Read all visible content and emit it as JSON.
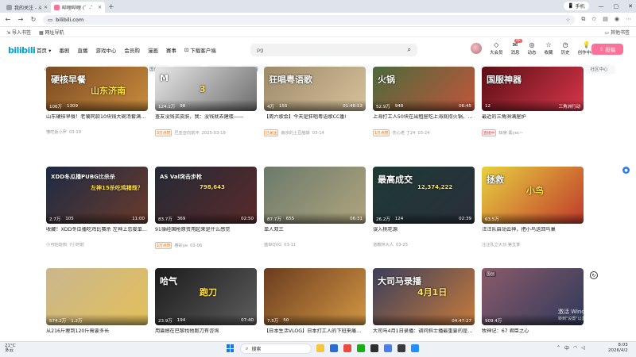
{
  "browser": {
    "tabs": [
      {
        "label": "我的关注 - 斗鱼",
        "active": false
      },
      {
        "label": "哔哩哔哩 (゜-゜)つ",
        "active": true
      }
    ],
    "new_tab": "+",
    "window_controls": [
      "—",
      "▢",
      "✕"
    ],
    "profile_badge": "手机",
    "url": "bilibili.com",
    "bookmarks": [
      "导入书签",
      "网址导航"
    ],
    "other_bookmarks": "其他书签"
  },
  "site": {
    "logo": "bilibili",
    "topnav": [
      "首页",
      "番剧",
      "直播",
      "游戏中心",
      "会员购",
      "漫画",
      "赛事",
      "下载客户端"
    ],
    "search_placeholder": "pg",
    "right_nav": [
      {
        "label": "大会员",
        "icon": "◇"
      },
      {
        "label": "消息",
        "icon": "✉",
        "count": "46"
      },
      {
        "label": "动态",
        "icon": "◎"
      },
      {
        "label": "收藏",
        "icon": "☆"
      },
      {
        "label": "历史",
        "icon": "◷"
      },
      {
        "label": "创作中心",
        "icon": "💡"
      }
    ],
    "upload_label": "投稿",
    "channels_main": [
      "动态",
      "热门"
    ],
    "channel_chips": [
      "番剧",
      "国创",
      "综艺",
      "动画",
      "鬼畜",
      "舞蹈",
      "娱乐",
      "科技数码",
      "美食",
      "汽车",
      "体育运动",
      "vlog",
      "专栏",
      "活动",
      "社区中心"
    ]
  },
  "cards": [
    {
      "title": "山东硬核早餐！老饕同款10块钱大碗汤套满纯牛肉！南方小伙一口香迷糊了~",
      "views": "106万",
      "comments": "1309",
      "duration": "",
      "author": "懂吃饭小罗",
      "date": "03-19",
      "tag": "",
      "thumb_text": [
        "硬核早餐",
        "山东济南"
      ],
      "colors": [
        "#7a4a22",
        "#c98b3c"
      ]
    },
    {
      "title": "查友没钱买皮肤，我：没钱就去建楼——",
      "views": "124.1万",
      "comments": "98",
      "duration": "",
      "author": "巴亚亚向前冲",
      "date": "2025-03-18",
      "tag": "3万点赞",
      "thumb_text": [
        "M",
        "3"
      ],
      "colors": [
        "#e8e8e8",
        "#6d6d6d"
      ]
    },
    {
      "title": "【周六歌会】今天是狂唱粤语歌CC番!",
      "views": "4万",
      "comments": "155",
      "duration": "01:48:53",
      "author": "南京的土豆脑袋",
      "date": "03-14",
      "tag": "已关注",
      "thumb_text": [
        "狂唱粤语歌"
      ],
      "colors": [
        "#9c8a6a",
        "#d6c19a"
      ]
    },
    {
      "title": "上海打工人50块在出租屋吃上海底捞火锅，简单又满足",
      "views": "52.9万",
      "comments": "948",
      "duration": "06:45",
      "author": "伤心老 丁24",
      "date": "03-24",
      "tag": "1万点赞",
      "thumb_text": [
        "火锅"
      ],
      "colors": [
        "#4b6a3b",
        "#c2553b"
      ]
    },
    {
      "title": "最近的三角洲满屋护",
      "views": "12",
      "comments": "",
      "duration": "三角洲行动",
      "author": "缺席 黑yec~",
      "date": "",
      "tag": "直播中",
      "thumb_text": [
        "国服神器"
      ],
      "colors": [
        "#5a0f14",
        "#d8364a"
      ]
    },
    {
      "title": "收藏！XDD冬瓜播吃鸡比赛杀 左神上恋度单人15杀！骑你的没看到人也打 给冬瓜送 …",
      "views": "2.7万",
      "comments": "105",
      "duration": "11:00",
      "author": "小可怕烧肉",
      "date": "7小时前",
      "tag": "",
      "thumb_text": [
        "XDD冬瓜播PUBG比杀杀",
        "左神15杀吃鸡猪哉？"
      ],
      "colors": [
        "#1d2a44",
        "#6a3b2b"
      ]
    },
    {
      "title": "91操经国枪原资用起来是什么感觉",
      "views": "83.7万",
      "comments": "369",
      "duration": "02:50",
      "author": "春彩ye",
      "date": "03-06",
      "tag": "1万点赞",
      "thumb_text": [
        "AS Val突击步枪",
        "798,643"
      ],
      "colors": [
        "#242a36",
        "#5a2a2a"
      ]
    },
    {
      "title": "单人双三",
      "views": "87.7万",
      "comments": "655",
      "duration": "06:31",
      "author": "盛世QVG",
      "date": "03-11",
      "tag": "",
      "thumb_text": [],
      "colors": [
        "#6b7a6b",
        "#b0a47e"
      ]
    },
    {
      "title": "误入桃花源",
      "views": "26.2万",
      "comments": "124",
      "duration": "02:39",
      "author": "道教林大人",
      "date": "03-25",
      "tag": "",
      "thumb_text": [
        "最高成交",
        "12,374,222"
      ],
      "colors": [
        "#1e3a36",
        "#2a2f3a"
      ]
    },
    {
      "title": "汪汪队启动云神，把小鸟送回鸟巢",
      "views": "63.5万",
      "comments": "",
      "duration": "",
      "author": "汪汪队立大功 第五季",
      "date": "",
      "tag": "",
      "thumb_text": [
        "拯救",
        "小鸟"
      ],
      "colors": [
        "#e8d040",
        "#c0392b"
      ]
    },
    {
      "title": "从216斤瘦到120斤需要多长",
      "views": "574.2万",
      "comments": "1.2万",
      "duration": "",
      "author": "",
      "date": "",
      "tag": "",
      "thumb_text": [],
      "colors": [
        "#c9b68d",
        "#e3c05a"
      ]
    },
    {
      "title": "用震撼在巴黎找他跑刀有咨询",
      "views": "23.9万",
      "comments": "194",
      "duration": "07:40",
      "author": "",
      "date": "",
      "tag": "",
      "thumb_text": [
        "哈气",
        "跑刀"
      ],
      "colors": [
        "#1b1b1b",
        "#5d5d5d"
      ]
    },
    {
      "title": "【日本生活VLOG】日本打工人的下班来痛时光，宽痛商场咖一整天的咖啡",
      "views": "7.5万",
      "comments": "50",
      "duration": "",
      "author": "",
      "date": "",
      "tag": "",
      "thumb_text": [],
      "colors": [
        "#6a3c1e",
        "#d29644"
      ]
    },
    {
      "title": "大司马4月1日录播：调问斜士播最重要的是什么",
      "views": "",
      "comments": "",
      "duration": "04:47:27",
      "author": "",
      "date": "",
      "tag": "",
      "thumb_text": [
        "大司马录播",
        "4月1日"
      ],
      "colors": [
        "#3b3f5a",
        "#c77a3c"
      ]
    },
    {
      "title": "牧神记：67 君臣之心",
      "views": "909.4万",
      "comments": "",
      "duration": "",
      "author": "",
      "date": "",
      "tag": "国创",
      "thumb_text": [],
      "colors": [
        "#8b5a6a",
        "#2f3a5a"
      ]
    }
  ],
  "watermark": {
    "line1": "激活 Windows",
    "line2": "转到\"设置\"以激活 Windows。"
  },
  "taskbar": {
    "weather_temp": "21°C",
    "weather_desc": "多云",
    "search_label": "搜索",
    "time": "8:03",
    "date": "2026/4/2",
    "input_method": "中",
    "app_colors": [
      "#f5c542",
      "#2b6cd3",
      "#e94b3c",
      "#1aad19",
      "#2f2f2f",
      "#4c7ee8",
      "#3a3a3a",
      "#1e90ff"
    ]
  }
}
